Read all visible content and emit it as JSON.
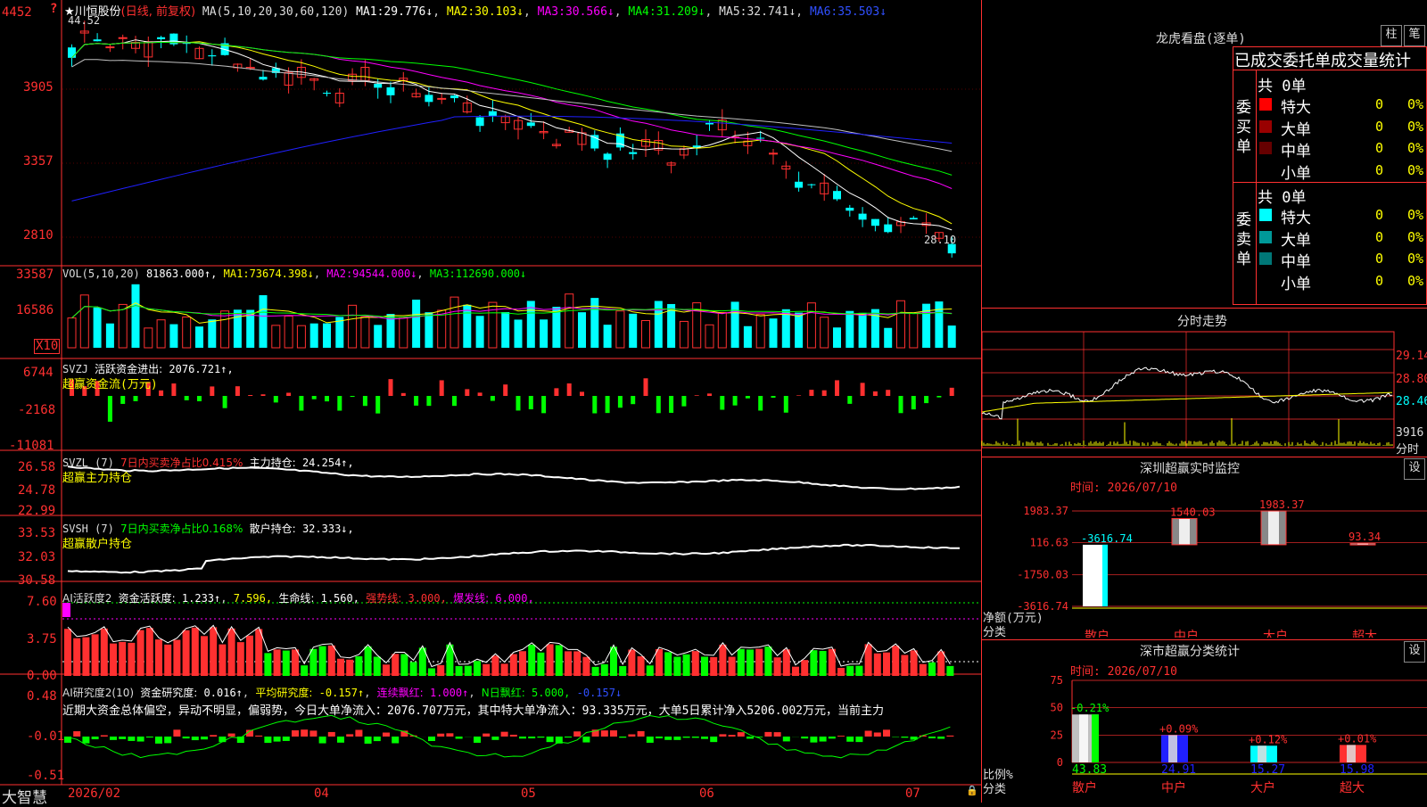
{
  "colors": {
    "up": "#ff3030",
    "down": "#00ffff",
    "green": "#00ff00",
    "yellow": "#ffff00",
    "magenta": "#ff00ff",
    "white": "#ffffff",
    "grid": "#aa0000",
    "axis": "#ff3030",
    "blue": "#2020ff",
    "gray": "#c0c0c0"
  },
  "app": {
    "logo": "大智慧",
    "stock_title": "★川恒股份",
    "stock_mode": "(日线, 前复权)"
  },
  "main": {
    "ma_label": "MA(5,10,20,30,60,120)",
    "ma": [
      {
        "name": "MA1:",
        "value": "29.776↓",
        "color": "#ffffff"
      },
      {
        "name": "MA2:",
        "value": "30.103↓",
        "color": "#ffff00"
      },
      {
        "name": "MA3:",
        "value": "30.566↓",
        "color": "#ff00ff"
      },
      {
        "name": "MA4:",
        "value": "31.209↓",
        "color": "#00ff00"
      },
      {
        "name": "MA5:",
        "value": "32.741↓",
        "color": "#c0c0c0"
      },
      {
        "name": "MA6:",
        "value": "35.503↓",
        "color": "#2020ff"
      }
    ],
    "y_ticks": [
      "4452",
      "3905",
      "3357",
      "2810"
    ],
    "high_label": "44.52",
    "low_label": "28.10",
    "corner_mark": "?"
  },
  "vol": {
    "label": "VOL(5,10,20)",
    "value": "81863.000↑,",
    "ma": [
      {
        "name": "MA1:",
        "value": "73674.398↓",
        "color": "#ffff00"
      },
      {
        "name": "MA2:",
        "value": "94544.000↓",
        "color": "#ff00ff"
      },
      {
        "name": "MA3:",
        "value": "112690.000↓",
        "color": "#00ff00"
      }
    ],
    "y_ticks": [
      "33587",
      "16586"
    ],
    "unit": "X10"
  },
  "svzj": {
    "label": "SVZJ",
    "title": "活跃资金进出:",
    "value": "2076.721↑,",
    "subtitle": "超赢资金流(万元)",
    "y_ticks": [
      "6744",
      "-2168",
      "-11081"
    ]
  },
  "svzl": {
    "label": "SVZL (7)",
    "ratio": "7日内买卖净占比0.415%",
    "hold_label": "主力持仓:",
    "hold_value": "24.254↑,",
    "subtitle": "超赢主力持仓",
    "y_ticks": [
      "26.58",
      "24.78",
      "22.99"
    ]
  },
  "svsh": {
    "label": "SVSH (7)",
    "ratio": "7日内买卖净占比0.168%",
    "hold_label": "散户持仓:",
    "hold_value": "32.333↓,",
    "subtitle": "超赢散户持仓",
    "y_ticks": [
      "33.53",
      "32.03",
      "30.58"
    ]
  },
  "ai1": {
    "label": "AI活跃度2",
    "active_label": "资金活跃度:",
    "active_value": "1.233↑",
    "v2": "7.596,",
    "life_label": "生命线:",
    "life_value": "1.560,",
    "strong_label": "强势线:",
    "strong_value": "3.000,",
    "burst_label": "爆发线:",
    "burst_value": "6.000,",
    "y_ticks": [
      "7.60",
      "3.75",
      "0.00"
    ]
  },
  "ai2": {
    "label": "AI研究度2(10)",
    "research_label": "资金研究度:",
    "research_value": "0.016↑",
    "avg_label": "平均研究度:",
    "avg_value": "-0.157↑",
    "red_label": "连续飘红:",
    "red_value": "1.000↑",
    "n_label": "N日飘红:",
    "n_value": "5.000,",
    "tail_value": "-0.157↓",
    "comment": "近期大资金总体偏空，异动不明显，偏弱势，今日大单净流入：2076.707万元，其中特大单净流入：93.335万元，大单5日累计净入5206.002万元，当前主力",
    "y_ticks": [
      "0.48",
      "-0.01",
      "-0.51"
    ]
  },
  "x_axis": [
    "2026/02",
    "04",
    "05",
    "06",
    "07"
  ],
  "lhb": {
    "title": "龙虎看盘(逐单)",
    "btn1": "柱",
    "btn2": "笔",
    "header": "已成交委托单成交量统计",
    "buy": {
      "side": "委买单",
      "total": "共 0单",
      "rows": [
        {
          "label": "特大",
          "qty": "0",
          "pct": "0%",
          "color": "#ff0000"
        },
        {
          "label": "大单",
          "qty": "0",
          "pct": "0%",
          "color": "#990000"
        },
        {
          "label": "中单",
          "qty": "0",
          "pct": "0%",
          "color": "#660000"
        },
        {
          "label": "小单",
          "qty": "0",
          "pct": "0%",
          "color": "#000000"
        }
      ]
    },
    "sell": {
      "side": "委卖单",
      "total": "共 0单",
      "rows": [
        {
          "label": "特大",
          "qty": "0",
          "pct": "0%",
          "color": "#00ffff"
        },
        {
          "label": "大单",
          "qty": "0",
          "pct": "0%",
          "color": "#009999"
        },
        {
          "label": "中单",
          "qty": "0",
          "pct": "0%",
          "color": "#007777"
        },
        {
          "label": "小单",
          "qty": "0",
          "pct": "0%",
          "color": "#000000"
        }
      ]
    }
  },
  "fenshi": {
    "title": "分时走势",
    "y_ticks": [
      "29.14",
      "28.80",
      "28.46"
    ],
    "vol_label": "3916",
    "unit_label": "分时"
  },
  "sz_monitor": {
    "title": "深圳超赢实时监控",
    "btn": "设",
    "time": "时间: 2026/07/10",
    "y_ticks": [
      "1983.37",
      "116.63",
      "-1750.03",
      "-3616.74"
    ],
    "unit1": "净额(万元)",
    "unit2": "分类",
    "bars": [
      {
        "cat": "散户",
        "value": -3616.74,
        "label": "-3616.74"
      },
      {
        "cat": "中户",
        "value": 1540.03,
        "label": "1540.03"
      },
      {
        "cat": "大户",
        "value": 1983.37,
        "label": "1983.37"
      },
      {
        "cat": "超大",
        "value": 93.34,
        "label": "93.34"
      }
    ]
  },
  "sz_stats": {
    "title": "深市超赢分类统计",
    "btn": "设",
    "time": "时间: 2026/07/10",
    "y_ticks": [
      "75",
      "50",
      "25",
      "0"
    ],
    "unit1": "比例%",
    "unit2": "分类",
    "bars": [
      {
        "cat": "散户",
        "value": 43.83,
        "label": "43.83",
        "delta": "-0.21%",
        "color": "#c0c0c0"
      },
      {
        "cat": "中户",
        "value": 24.91,
        "label": "24.91",
        "delta": "+0.09%",
        "color": "#2020ff"
      },
      {
        "cat": "大户",
        "value": 15.27,
        "label": "15.27",
        "delta": "+0.12%",
        "color": "#00ffff"
      },
      {
        "cat": "超大",
        "value": 15.98,
        "label": "15.98",
        "delta": "+0.01%",
        "color": "#ff3030"
      }
    ]
  }
}
